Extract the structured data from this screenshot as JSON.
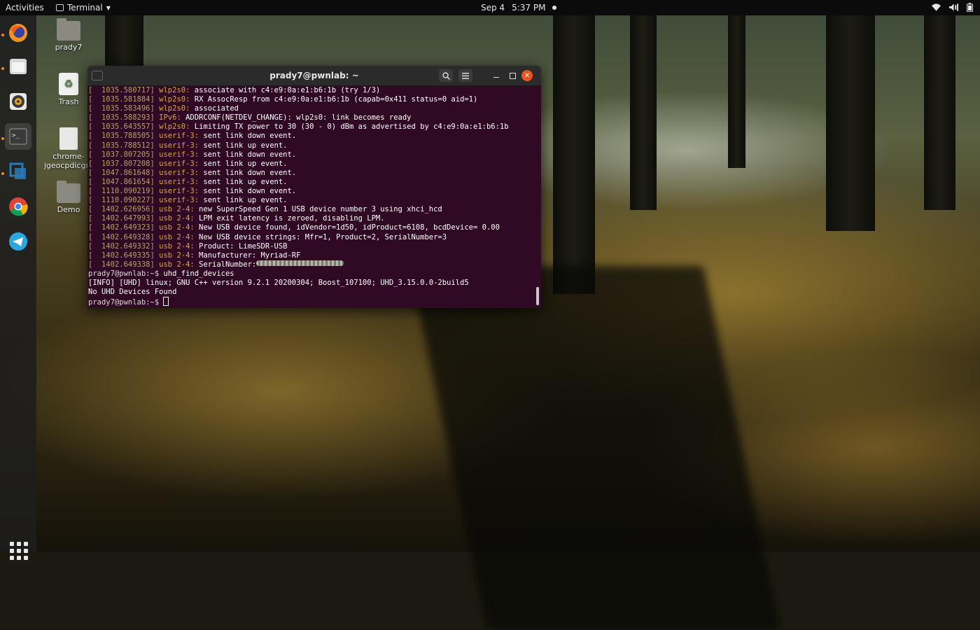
{
  "topbar": {
    "activities": "Activities",
    "app_menu": "Terminal",
    "date": "Sep 4",
    "time": "5:37 PM"
  },
  "dock": {
    "apps": [
      "firefox-icon",
      "files-icon",
      "rhythmbox-icon",
      "terminal-icon",
      "virtualbox-icon",
      "chrome-icon",
      "telegram-icon"
    ]
  },
  "desktop": {
    "icons": [
      {
        "label": "prady7"
      },
      {
        "label": "Trash"
      },
      {
        "label": "chrome-\njgeocpdicgm"
      },
      {
        "label": "Demo"
      }
    ]
  },
  "terminal": {
    "title": "prady7@pwnlab: ~",
    "lines": [
      {
        "ts": "[  1035.580717]",
        "src": "wlp2s0:",
        "msg": " associate with c4:e9:0a:e1:b6:1b (try 1/3)"
      },
      {
        "ts": "[  1035.581884]",
        "src": "wlp2s0:",
        "msg": " RX AssocResp from c4:e9:0a:e1:b6:1b (capab=0x411 status=0 aid=1)"
      },
      {
        "ts": "[  1035.583496]",
        "src": "wlp2s0:",
        "msg": " associated"
      },
      {
        "ts": "[  1035.588293]",
        "src": "IPv6:",
        "msg": " ADDRCONF(NETDEV_CHANGE): wlp2s0: link becomes ready"
      },
      {
        "ts": "[  1035.643557]",
        "src": "wlp2s0:",
        "msg": " Limiting TX power to 30 (30 - 0) dBm as advertised by c4:e9:0a:e1:b6:1b"
      },
      {
        "ts": "[  1035.788505]",
        "src": "userif-3:",
        "msg": " sent link down event."
      },
      {
        "ts": "[  1035.788512]",
        "src": "userif-3:",
        "msg": " sent link up event."
      },
      {
        "ts": "[  1037.807205]",
        "src": "userif-3:",
        "msg": " sent link down event."
      },
      {
        "ts": "[  1037.807208]",
        "src": "userif-3:",
        "msg": " sent link up event."
      },
      {
        "ts": "[  1047.861648]",
        "src": "userif-3:",
        "msg": " sent link down event."
      },
      {
        "ts": "[  1047.861654]",
        "src": "userif-3:",
        "msg": " sent link up event."
      },
      {
        "ts": "[  1110.090219]",
        "src": "userif-3:",
        "msg": " sent link down event."
      },
      {
        "ts": "[  1110.090227]",
        "src": "userif-3:",
        "msg": " sent link up event."
      },
      {
        "ts": "[  1402.626956]",
        "src": "usb 2-4:",
        "msg": " new SuperSpeed Gen 1 USB device number 3 using xhci_hcd"
      },
      {
        "ts": "[  1402.647993]",
        "src": "usb 2-4:",
        "msg": " LPM exit latency is zeroed, disabling LPM."
      },
      {
        "ts": "[  1402.649323]",
        "src": "usb 2-4:",
        "msg": " New USB device found, idVendor=1d50, idProduct=6108, bcdDevice= 0.00"
      },
      {
        "ts": "[  1402.649328]",
        "src": "usb 2-4:",
        "msg": " New USB device strings: Mfr=1, Product=2, SerialNumber=3"
      },
      {
        "ts": "[  1402.649332]",
        "src": "usb 2-4:",
        "msg": " Product: LimeSDR-USB"
      },
      {
        "ts": "[  1402.649335]",
        "src": "usb 2-4:",
        "msg": " Manufacturer: Myriad-RF"
      },
      {
        "ts": "[  1402.649338]",
        "src": "usb 2-4:",
        "msg": " SerialNumber:"
      }
    ],
    "command_prompt": "prady7@pwnlab:~$ ",
    "command": "uhd_find_devices",
    "info_line": "[INFO] [UHD] linux; GNU C++ version 9.2.1 20200304; Boost_107100; UHD_3.15.0.0-2build5",
    "result_line": "No UHD Devices Found",
    "final_prompt": "prady7@pwnlab:~$ "
  }
}
